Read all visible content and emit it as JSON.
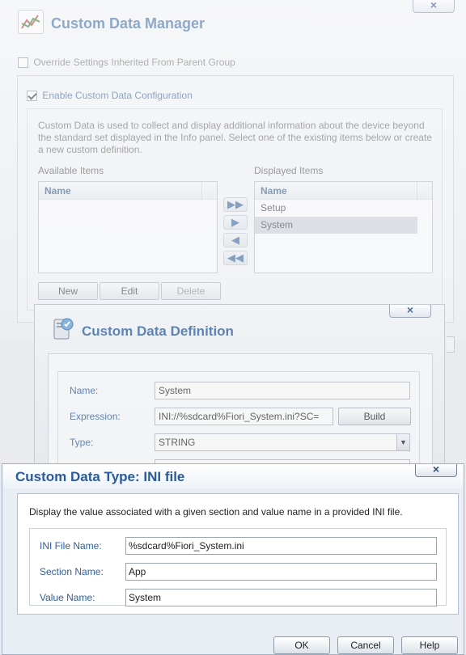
{
  "manager": {
    "close_glyph": "×",
    "title": "Custom Data Manager",
    "override_label": "Override Settings Inherited From Parent Group",
    "enable_label": "Enable Custom Data Configuration",
    "description": "Custom Data is used to collect and display additional information about the device beyond the standard set displayed in the Info panel. Select one of the existing items below or create a new custom definition.",
    "available": {
      "label": "Available Items",
      "column": "Name",
      "rows": []
    },
    "displayed": {
      "label": "Displayed Items",
      "column": "Name",
      "rows": [
        "Setup",
        "System"
      ],
      "selected": "System"
    },
    "buttons": {
      "new": "New",
      "edit": "Edit",
      "delete": "Delete"
    }
  },
  "definition": {
    "close_glyph": "×",
    "title": "Custom Data Definition",
    "name_label": "Name:",
    "name_value": "System",
    "expression_label": "Expression:",
    "expression_value": "INI://%sdcard%Fiori_System.ini?SC=",
    "build_label": "Build",
    "type_label": "Type:",
    "type_value": "STRING"
  },
  "ini_dialog": {
    "close_glyph": "×",
    "title": "Custom Data Type: INI file",
    "description": "Display the value associated with a given section and value name in a provided INI file.",
    "fields": {
      "file_label": "INI File Name:",
      "file_value": "%sdcard%Fiori_System.ini",
      "section_label": "Section Name:",
      "section_value": "App",
      "value_label": "Value Name:",
      "value_value": "System"
    },
    "buttons": {
      "ok": "OK",
      "cancel": "Cancel",
      "help": "Help"
    }
  },
  "icons": [
    "chart-icon",
    "definition-icon",
    "arrow-right-all-icon",
    "arrow-right-icon",
    "arrow-left-icon",
    "arrow-left-all-icon",
    "dropdown-arrow-icon",
    "close-icon"
  ],
  "colors": {
    "title_blue": "#3a6aa3",
    "label_blue": "#3d6ca6",
    "selected_row": "#cdd3db"
  }
}
